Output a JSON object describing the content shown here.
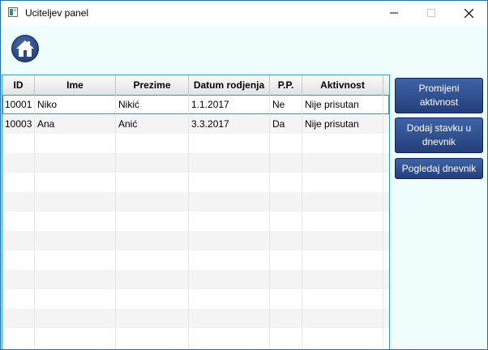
{
  "window": {
    "title": "Uciteljev panel",
    "minimize_icon": "minimize-icon",
    "maximize_icon": "maximize-icon",
    "close_icon": "close-icon"
  },
  "toolbar": {
    "home_icon": "home-icon"
  },
  "table": {
    "columns": [
      "ID",
      "Ime",
      "Prezime",
      "Datum rodjenja",
      "P.P.",
      "Aktivnost"
    ],
    "rows": [
      [
        "10001",
        "Niko",
        "Nikić",
        "1.1.2017",
        "Ne",
        "Nije prisutan"
      ],
      [
        "10003",
        "Ana",
        "Anić",
        "3.3.2017",
        "Da",
        "Nije prisutan"
      ]
    ]
  },
  "actions": {
    "change_activity": "Promijeni aktivnost",
    "add_entry": "Dodaj stavku u dnevnik",
    "view_journal": "Pogledaj dnevnik"
  }
}
